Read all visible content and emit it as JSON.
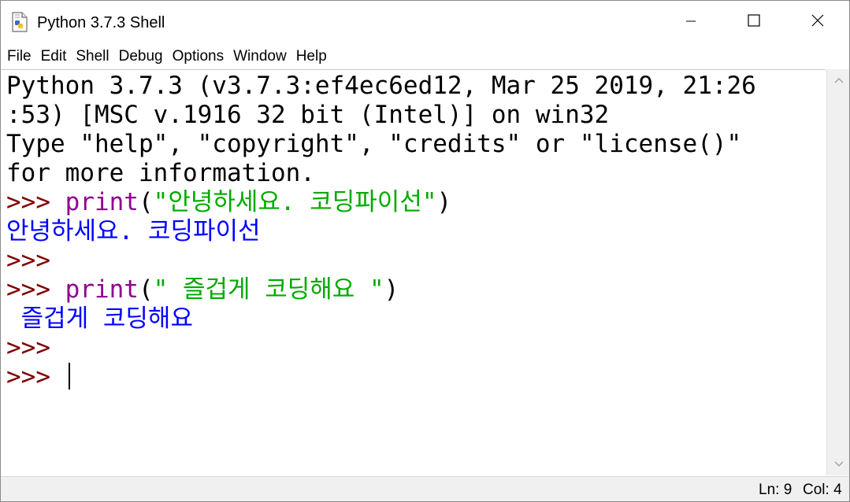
{
  "window": {
    "title": "Python 3.7.3 Shell"
  },
  "menu": [
    "File",
    "Edit",
    "Shell",
    "Debug",
    "Options",
    "Window",
    "Help"
  ],
  "shell": {
    "lines": [
      [
        {
          "text": "Python 3.7.3 (v3.7.3:ef4ec6ed12, Mar 25 2019, 21:26",
          "color": "#000000"
        }
      ],
      [
        {
          "text": ":53) [MSC v.1916 32 bit (Intel)] on win32",
          "color": "#000000"
        }
      ],
      [
        {
          "text": "Type \"help\", \"copyright\", \"credits\" or \"license()\"",
          "color": "#000000"
        }
      ],
      [
        {
          "text": "for more information.",
          "color": "#000000"
        }
      ],
      [
        {
          "text": ">>> ",
          "color": "#800000"
        },
        {
          "text": "print",
          "color": "#900090"
        },
        {
          "text": "(",
          "color": "#000000"
        },
        {
          "text": "\"안녕하세요. 코딩파이선\"",
          "color": "#00aa00"
        },
        {
          "text": ")",
          "color": "#000000"
        }
      ],
      [
        {
          "text": "안녕하세요. 코딩파이선",
          "color": "#0000ff"
        }
      ],
      [
        {
          "text": ">>>",
          "color": "#800000"
        }
      ],
      [
        {
          "text": ">>> ",
          "color": "#800000"
        },
        {
          "text": "print",
          "color": "#900090"
        },
        {
          "text": "(",
          "color": "#000000"
        },
        {
          "text": "\" 즐겁게 코딩해요 \"",
          "color": "#00aa00"
        },
        {
          "text": ")",
          "color": "#000000"
        }
      ],
      [
        {
          "text": " 즐겁게 코딩해요",
          "color": "#0000ff"
        }
      ],
      [
        {
          "text": ">>>",
          "color": "#800000"
        }
      ],
      [
        {
          "text": ">>> ",
          "color": "#800000"
        }
      ]
    ],
    "cursor_line": 10
  },
  "status": {
    "ln": "Ln: 9",
    "col": "Col: 4"
  },
  "icons": {
    "app": "python-file-icon",
    "minimize": "minimize-icon",
    "maximize": "maximize-icon",
    "close": "close-icon",
    "scroll_up": "scroll-up-arrow-icon",
    "scroll_down": "scroll-down-arrow-icon"
  }
}
